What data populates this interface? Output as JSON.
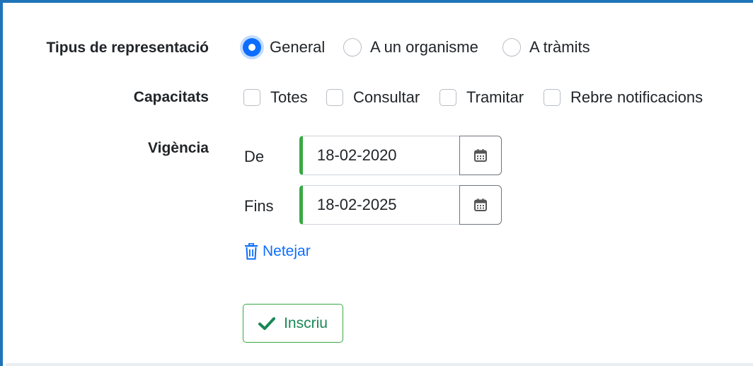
{
  "form": {
    "tipus": {
      "label": "Tipus de representació",
      "options": [
        {
          "label": "General",
          "checked": true
        },
        {
          "label": "A un organisme",
          "checked": false
        },
        {
          "label": "A tràmits",
          "checked": false
        }
      ]
    },
    "capacitats": {
      "label": "Capacitats",
      "options": [
        {
          "label": "Totes",
          "checked": false
        },
        {
          "label": "Consultar",
          "checked": false
        },
        {
          "label": "Tramitar",
          "checked": false
        },
        {
          "label": "Rebre notificacions",
          "checked": false
        }
      ]
    },
    "vigencia": {
      "label": "Vigència",
      "from_label": "De",
      "from_value": "18-02-2020",
      "to_label": "Fins",
      "to_value": "18-02-2025",
      "clear_label": "Netejar"
    },
    "submit_label": "Inscriu"
  },
  "icons": {
    "calendar": "calendar-icon",
    "trash": "trash-icon",
    "check": "check-icon"
  },
  "colors": {
    "primary": "#0d6efd",
    "success": "#3aa845",
    "frame": "#1f74b9"
  }
}
